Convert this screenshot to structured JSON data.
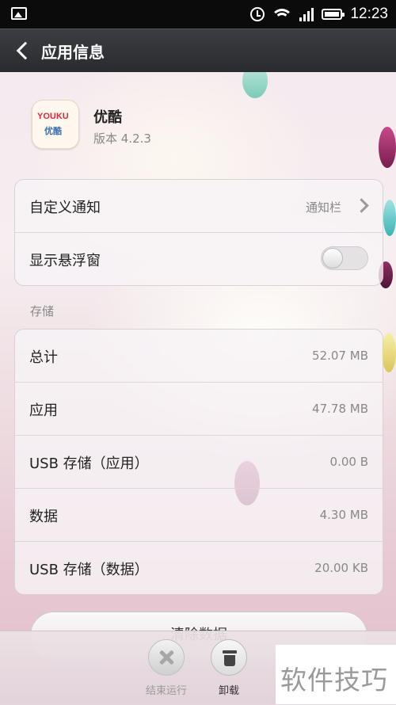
{
  "status_bar": {
    "time": "12:23",
    "icons": [
      "picture-icon",
      "alarm-icon",
      "wifi-icon",
      "signal-icon",
      "battery-icon"
    ]
  },
  "title_bar": {
    "back_icon": "chevron-left-icon",
    "title": "应用信息"
  },
  "app": {
    "name": "优酷",
    "version": "版本 4.2.3",
    "logo_text_top": "YOUKU",
    "logo_text_bottom": "优酷"
  },
  "settings": {
    "notification_label": "自定义通知",
    "notification_value": "通知栏",
    "floating_window_label": "显示悬浮窗",
    "floating_window_enabled": false
  },
  "storage": {
    "section_label": "存储",
    "rows": [
      {
        "label": "总计",
        "value": "52.07 MB"
      },
      {
        "label": "应用",
        "value": "47.78 MB"
      },
      {
        "label": "USB 存储（应用）",
        "value": "0.00 B"
      },
      {
        "label": "数据",
        "value": "4.30 MB"
      },
      {
        "label": "USB 存储（数据）",
        "value": "20.00 KB"
      }
    ]
  },
  "clear_data_button": "清除数据",
  "bottom_actions": {
    "force_stop_label": "结束运行",
    "uninstall_label": "卸载"
  },
  "watermark": "软件技巧",
  "colors": {
    "title_bar": "#2f3034",
    "status_bar": "#0b0b0b",
    "accent_gem_purple": "#8e1f56"
  }
}
